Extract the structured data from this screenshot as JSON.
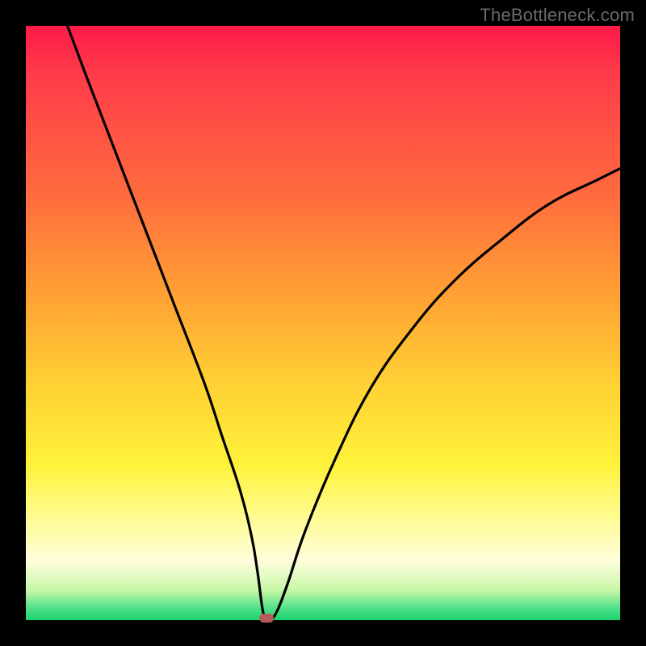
{
  "watermark": "TheBottleneck.com",
  "chart_data": {
    "type": "line",
    "title": "",
    "xlabel": "",
    "ylabel": "",
    "xlim": [
      0,
      100
    ],
    "ylim": [
      0,
      100
    ],
    "series": [
      {
        "name": "bottleneck-curve",
        "x": [
          7,
          10,
          15,
          20,
          25,
          30,
          33,
          36,
          38,
          39,
          40,
          41,
          42,
          44,
          47,
          52,
          58,
          65,
          72,
          80,
          88,
          96,
          100
        ],
        "y": [
          100,
          92,
          79,
          66,
          53,
          40,
          31,
          22,
          14,
          8,
          1,
          0.5,
          1,
          6,
          15,
          27,
          39,
          49,
          57,
          64,
          70,
          74,
          76
        ]
      }
    ],
    "marker": {
      "x": 40.5,
      "y": 0.4
    },
    "background_gradient": {
      "stops": [
        {
          "pos": 0,
          "color": "#ff1a4a"
        },
        {
          "pos": 28,
          "color": "#ff6a3e"
        },
        {
          "pos": 60,
          "color": "#ffd033"
        },
        {
          "pos": 82,
          "color": "#fffb8a"
        },
        {
          "pos": 95,
          "color": "#c7f7a8"
        },
        {
          "pos": 100,
          "color": "#19d36b"
        }
      ]
    }
  }
}
